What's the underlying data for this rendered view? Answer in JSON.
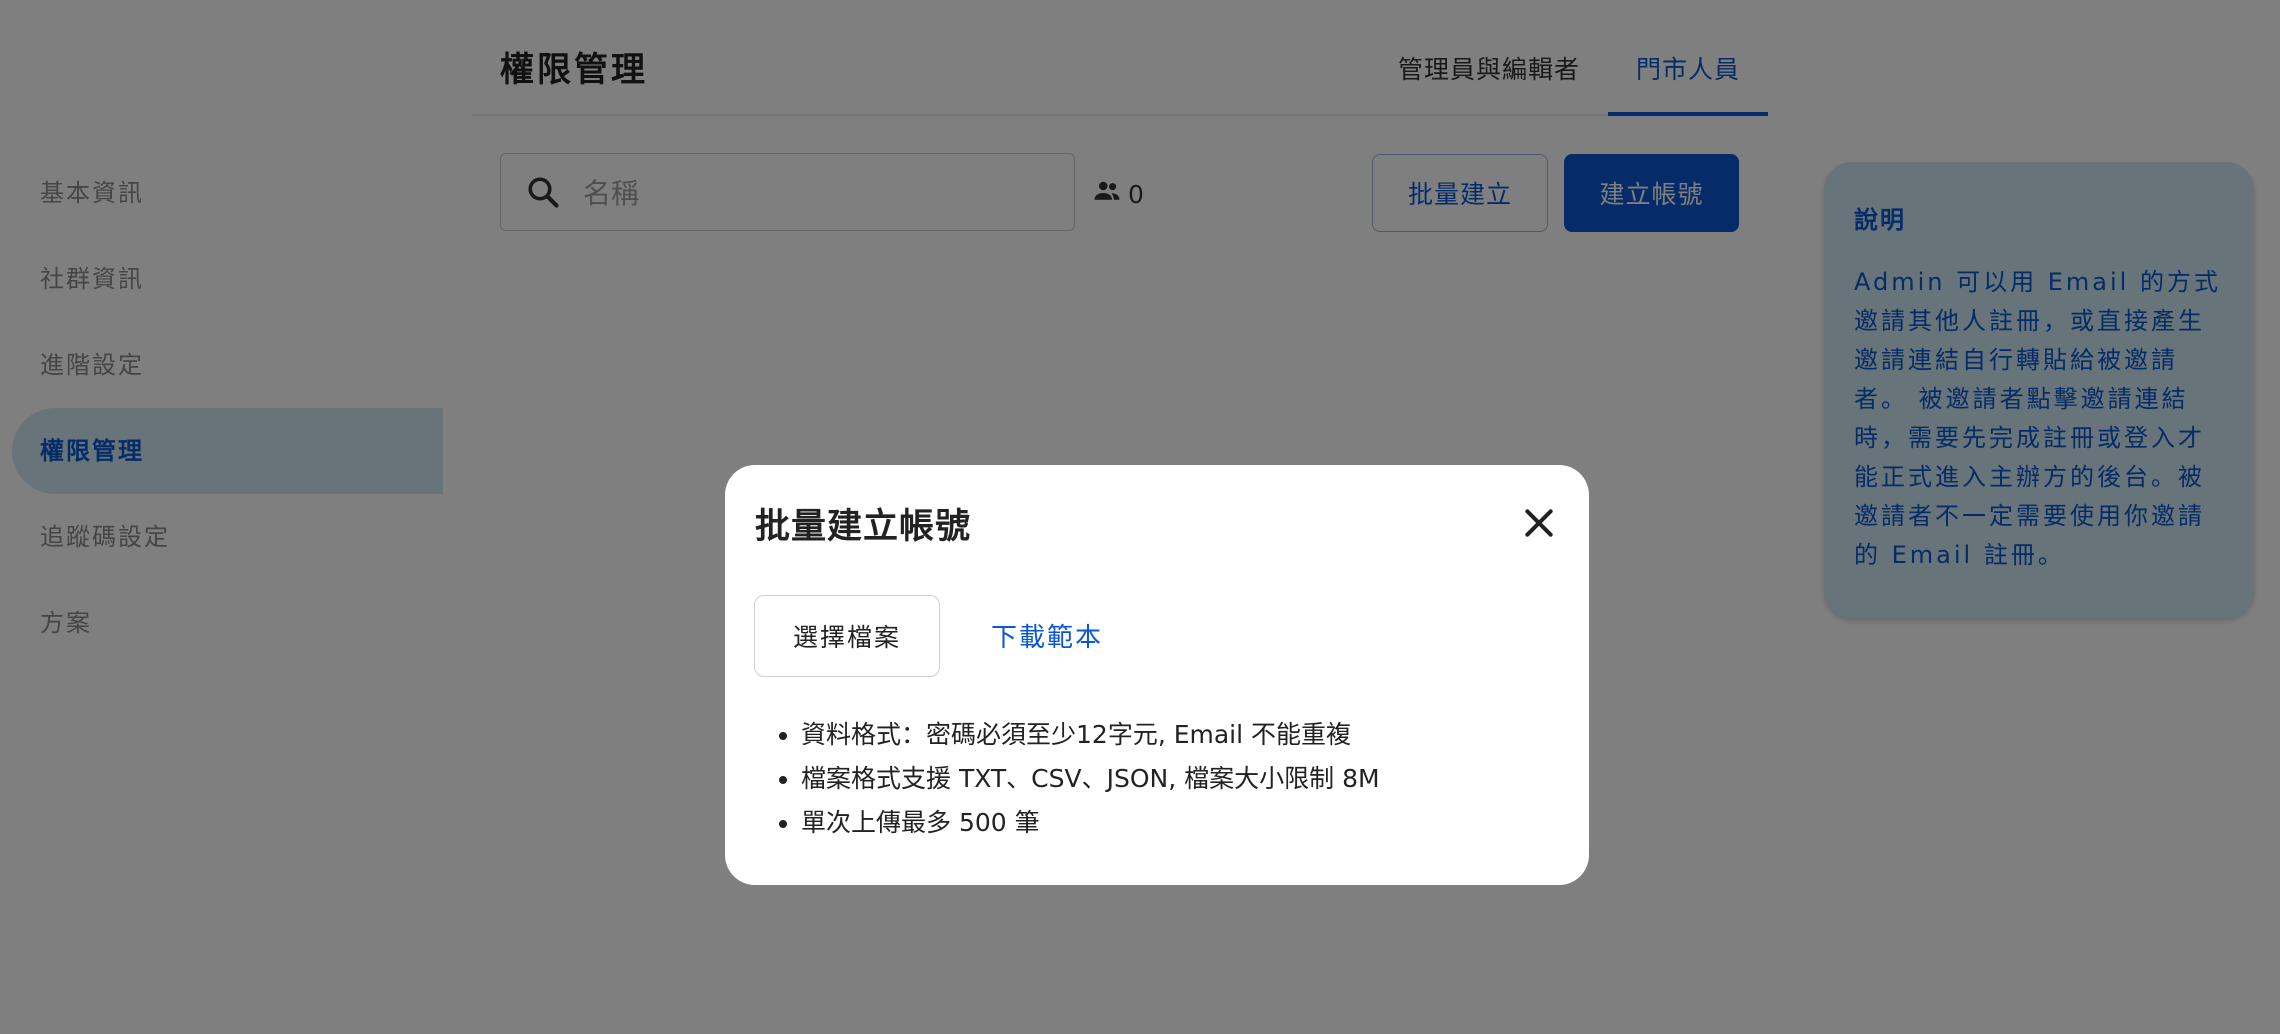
{
  "sidebar": {
    "items": [
      {
        "label": "基本資訊"
      },
      {
        "label": "社群資訊"
      },
      {
        "label": "進階設定"
      },
      {
        "label": "權限管理",
        "active": true
      },
      {
        "label": "追蹤碼設定"
      },
      {
        "label": "方案"
      }
    ]
  },
  "header": {
    "title": "權限管理",
    "tabs": [
      {
        "label": "管理員與編輯者"
      },
      {
        "label": "門市人員",
        "active": true
      }
    ]
  },
  "toolbar": {
    "search_placeholder": "名稱",
    "search_value": "",
    "member_count": "0",
    "bulk_create_label": "批量建立",
    "create_account_label": "建立帳號"
  },
  "info_panel": {
    "title": "說明",
    "body": "Admin 可以用 Email 的方式邀請其他人註冊，或直接產生邀請連結自行轉貼給被邀請者。 被邀請者點擊邀請連結時，需要先完成註冊或登入才能正式進入主辦方的後台。被邀請者不一定需要使用你邀請的 Email 註冊。"
  },
  "modal": {
    "title": "批量建立帳號",
    "choose_file_label": "選擇檔案",
    "download_template_label": "下載範本",
    "notes": [
      "資料格式：密碼必須至少12字元, Email 不能重複",
      "檔案格式支援 TXT、CSV、JSON, 檔案大小限制 8M",
      "單次上傳最多 500 筆"
    ]
  },
  "colors": {
    "accent": "#0b57d0",
    "info_bg": "#cfe8f3",
    "overlay": "rgba(0,0,0,0.5)"
  },
  "icons": {
    "search": "search-icon",
    "people": "people-icon",
    "close": "close-icon"
  }
}
